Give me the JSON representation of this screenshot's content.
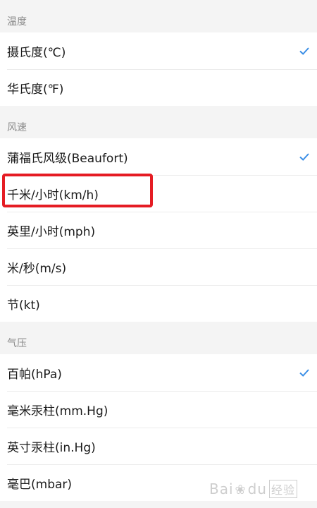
{
  "accent_color": "#3a8ee6",
  "highlight_color": "#e51c23",
  "sections": {
    "temperature": {
      "header": "温度",
      "items": [
        {
          "label": "摄氏度(℃)",
          "selected": true
        },
        {
          "label": "华氏度(℉)",
          "selected": false
        }
      ]
    },
    "wind": {
      "header": "风速",
      "items": [
        {
          "label": "蒲福氏风级(Beaufort)",
          "selected": true
        },
        {
          "label": "千米/小时(km/h)",
          "selected": false
        },
        {
          "label": "英里/小时(mph)",
          "selected": false
        },
        {
          "label": "米/秒(m/s)",
          "selected": false
        },
        {
          "label": "节(kt)",
          "selected": false
        }
      ]
    },
    "pressure": {
      "header": "气压",
      "items": [
        {
          "label": "百帕(hPa)",
          "selected": true
        },
        {
          "label": "毫米汞柱(mm.Hg)",
          "selected": false
        },
        {
          "label": "英寸汞柱(in.Hg)",
          "selected": false
        },
        {
          "label": "毫巴(mbar)",
          "selected": false
        }
      ]
    }
  },
  "watermark": {
    "text": "Bai",
    "text2": "du",
    "sub": "经验"
  },
  "icons": {
    "check": "check-icon",
    "paw": "paw-icon"
  }
}
